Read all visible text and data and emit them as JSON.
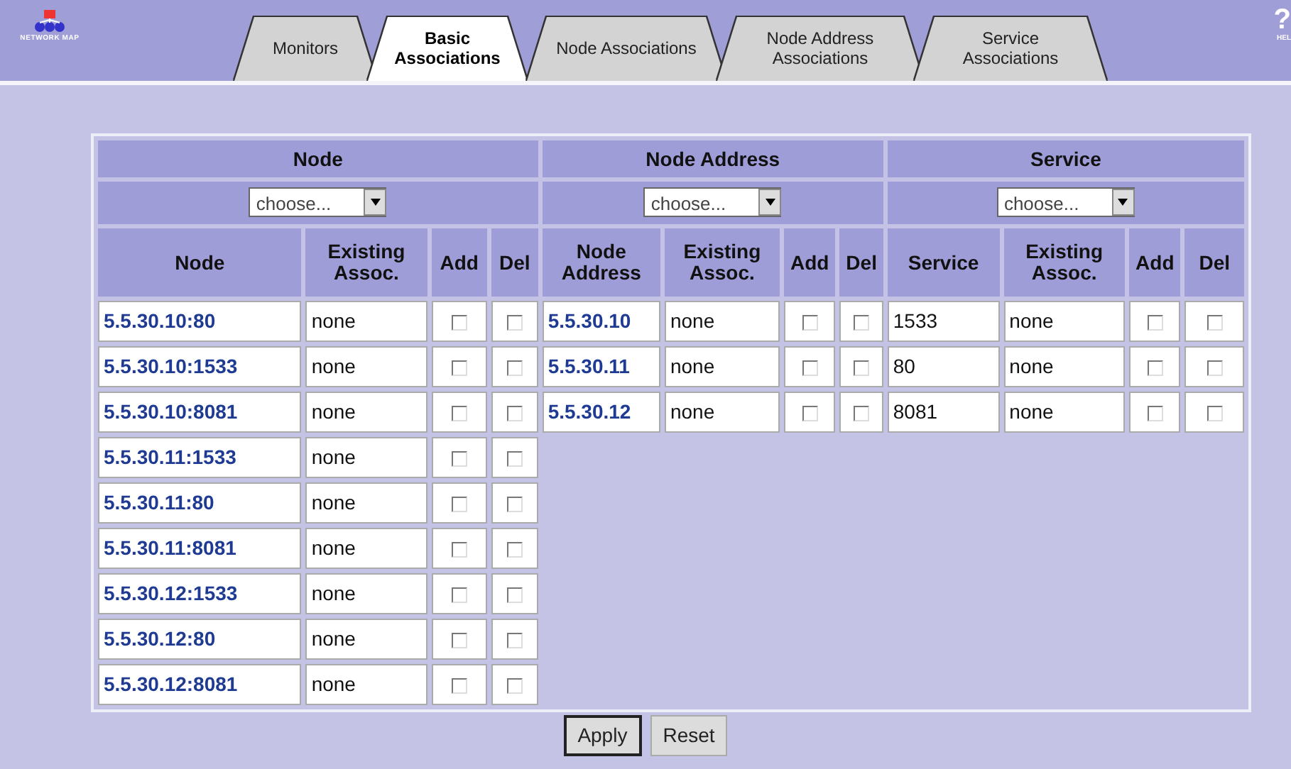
{
  "header": {
    "logo_text": "NETWORK MAP",
    "help_mark": "?",
    "help_text": "HEL"
  },
  "tabs": [
    {
      "label": "Monitors",
      "selected": false
    },
    {
      "label": "Basic Associations",
      "selected": true
    },
    {
      "label": "Node Associations",
      "selected": false
    },
    {
      "label": "Node Address Associations",
      "selected": false
    },
    {
      "label": "Service Associations",
      "selected": false
    }
  ],
  "sections": [
    {
      "title": "Node",
      "dropdown": "choose...",
      "kind": "link",
      "columns": [
        "Node",
        "Existing Assoc.",
        "Add",
        "Del"
      ],
      "rows": [
        {
          "name": "5.5.30.10:80",
          "existing": "none",
          "add": false,
          "del": false
        },
        {
          "name": "5.5.30.10:1533",
          "existing": "none",
          "add": false,
          "del": false
        },
        {
          "name": "5.5.30.10:8081",
          "existing": "none",
          "add": false,
          "del": false
        },
        {
          "name": "5.5.30.11:1533",
          "existing": "none",
          "add": false,
          "del": false
        },
        {
          "name": "5.5.30.11:80",
          "existing": "none",
          "add": false,
          "del": false
        },
        {
          "name": "5.5.30.11:8081",
          "existing": "none",
          "add": false,
          "del": false
        },
        {
          "name": "5.5.30.12:1533",
          "existing": "none",
          "add": false,
          "del": false
        },
        {
          "name": "5.5.30.12:80",
          "existing": "none",
          "add": false,
          "del": false
        },
        {
          "name": "5.5.30.12:8081",
          "existing": "none",
          "add": false,
          "del": false
        }
      ]
    },
    {
      "title": "Node Address",
      "dropdown": "choose...",
      "kind": "link",
      "columns": [
        "Node Address",
        "Existing Assoc.",
        "Add",
        "Del"
      ],
      "rows": [
        {
          "name": "5.5.30.10",
          "existing": "none",
          "add": false,
          "del": false
        },
        {
          "name": "5.5.30.11",
          "existing": "none",
          "add": false,
          "del": false
        },
        {
          "name": "5.5.30.12",
          "existing": "none",
          "add": false,
          "del": false
        }
      ]
    },
    {
      "title": "Service",
      "dropdown": "choose...",
      "kind": "plain",
      "columns": [
        "Service",
        "Existing Assoc.",
        "Add",
        "Del"
      ],
      "rows": [
        {
          "name": "1533",
          "existing": "none",
          "add": false,
          "del": false
        },
        {
          "name": "80",
          "existing": "none",
          "add": false,
          "del": false
        },
        {
          "name": "8081",
          "existing": "none",
          "add": false,
          "del": false
        }
      ]
    }
  ],
  "buttons": [
    {
      "label": "Apply",
      "default": true
    },
    {
      "label": "Reset",
      "default": false
    }
  ]
}
